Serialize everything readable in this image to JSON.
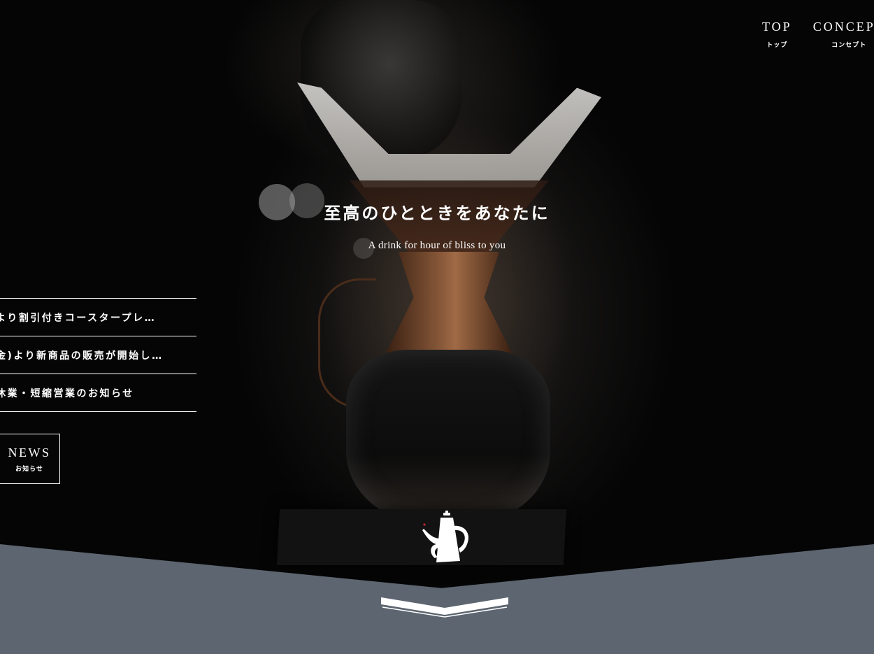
{
  "nav": {
    "items": [
      {
        "en": "TOP",
        "ja": "トップ"
      },
      {
        "en": "CONCEPT",
        "ja": "コンセプト"
      }
    ]
  },
  "hero": {
    "headline": "至高のひとときをあなたに",
    "subline": "A drink for hour of bliss to you"
  },
  "news": {
    "items": [
      "より割引付きコースタープレ…",
      "金)より新商品の販売が開始し…",
      "休業・短縮営業のお知らせ"
    ],
    "button": {
      "en": "NEWS",
      "ja": "お知らせ"
    }
  },
  "icons": {
    "kettle": "kettle-icon",
    "scroll": "chevron-down-icon"
  },
  "colors": {
    "band": "#5c6570",
    "text": "#ffffff",
    "background": "#000000"
  }
}
